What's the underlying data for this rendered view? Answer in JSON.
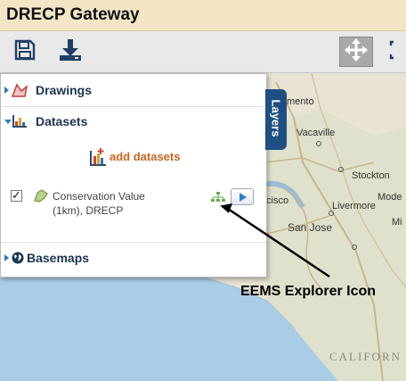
{
  "app": {
    "title": "DRECP Gateway"
  },
  "toolbar": {
    "buttons": [
      {
        "name": "save-icon"
      },
      {
        "name": "download-icon"
      },
      {
        "name": "pan-icon",
        "active": true
      },
      {
        "name": "extent-icon"
      }
    ]
  },
  "layers_panel": {
    "tab_label": "Layers",
    "sections": [
      {
        "label": "Drawings",
        "icon": "drawings-icon",
        "expanded": false
      },
      {
        "label": "Datasets",
        "icon": "datasets-icon",
        "expanded": true
      },
      {
        "label": "Basemaps",
        "icon": "globe-icon",
        "expanded": false
      }
    ],
    "add_datasets_label": "add datasets",
    "dataset": {
      "label_line1": "Conservation Value",
      "label_line2": "(1km), DRECP",
      "checked": true,
      "check_glyph": "✓"
    }
  },
  "map": {
    "place_labels": [
      "mento",
      "Vacaville",
      "Stockton",
      "Livermore",
      "Mode",
      "San Jose",
      "cisco",
      "Mi"
    ],
    "state_label": "CALIFORN"
  },
  "annotation": {
    "callout": "EEMS Explorer Icon"
  },
  "colors": {
    "accent": "#3577b5",
    "title_bar": "#f3e6c6",
    "layers_tab": "#1f4f82",
    "add_datasets": "#c9651f"
  }
}
